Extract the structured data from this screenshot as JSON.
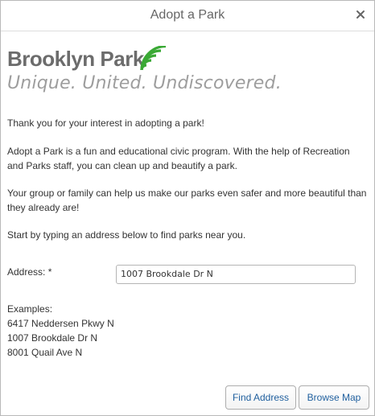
{
  "dialog": {
    "title": "Adopt a Park",
    "close_label": "×"
  },
  "logo": {
    "name": "Brooklyn Park",
    "tagline": "Unique. United. Undiscovered.",
    "arc_color": "#3aa935",
    "name_color": "#6c6c6c",
    "tagline_color": "#9d9d9d"
  },
  "intro": {
    "p1": "Thank you for your interest in adopting a park!",
    "p2": "Adopt a Park is a fun and educational civic program. With the help of Recreation and Parks staff, you can clean up and beautify a park.",
    "p3": "Your group or family can help us make our parks even safer and more beautiful than they already are!",
    "p4": "Start by typing an address below to find parks near you."
  },
  "address": {
    "label": "Address: *",
    "value": "1007 Brookdale Dr N"
  },
  "examples": {
    "heading": "Examples:",
    "items": [
      "6417 Neddersen Pkwy N",
      "1007 Brookdale Dr N",
      "8001 Quail Ave N"
    ]
  },
  "buttons": {
    "find": "Find Address",
    "browse": "Browse Map"
  },
  "colors": {
    "button_text": "#1f5f9e",
    "border": "#b9b9b9"
  }
}
